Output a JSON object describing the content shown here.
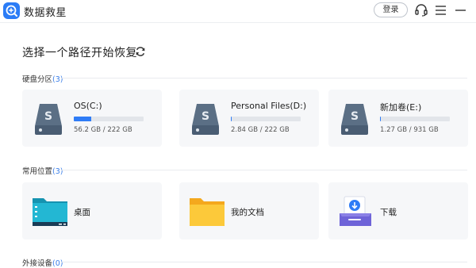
{
  "app": {
    "title": "数据救星"
  },
  "titlebar": {
    "login_label": "登录"
  },
  "main": {
    "heading": "选择一个路径开始恢复"
  },
  "sections": {
    "drives": {
      "label": "硬盘分区",
      "count": "(3)",
      "items": [
        {
          "name": "OS(C:)",
          "size_text": "56.2 GB / 222 GB",
          "used_fraction": 0.253
        },
        {
          "name": "Personal Files(D:)",
          "size_text": "2.84 GB / 222 GB",
          "used_fraction": 0.013
        },
        {
          "name": "新加卷(E:)",
          "size_text": "1.27 GB / 931 GB",
          "used_fraction": 0.0014
        }
      ]
    },
    "locations": {
      "label": "常用位置",
      "count": "(3)",
      "items": [
        {
          "name": "桌面",
          "icon": "desktop-folder-icon"
        },
        {
          "name": "我的文档",
          "icon": "documents-folder-icon"
        },
        {
          "name": "下载",
          "icon": "download-tray-icon"
        }
      ]
    },
    "external": {
      "label": "外接设备",
      "count": "(0)"
    }
  },
  "colors": {
    "accent": "#2f7cf6",
    "count_text": "#3a7ee8",
    "card_bg": "#f6f7f9",
    "drive_icon": "#5b6f85"
  }
}
